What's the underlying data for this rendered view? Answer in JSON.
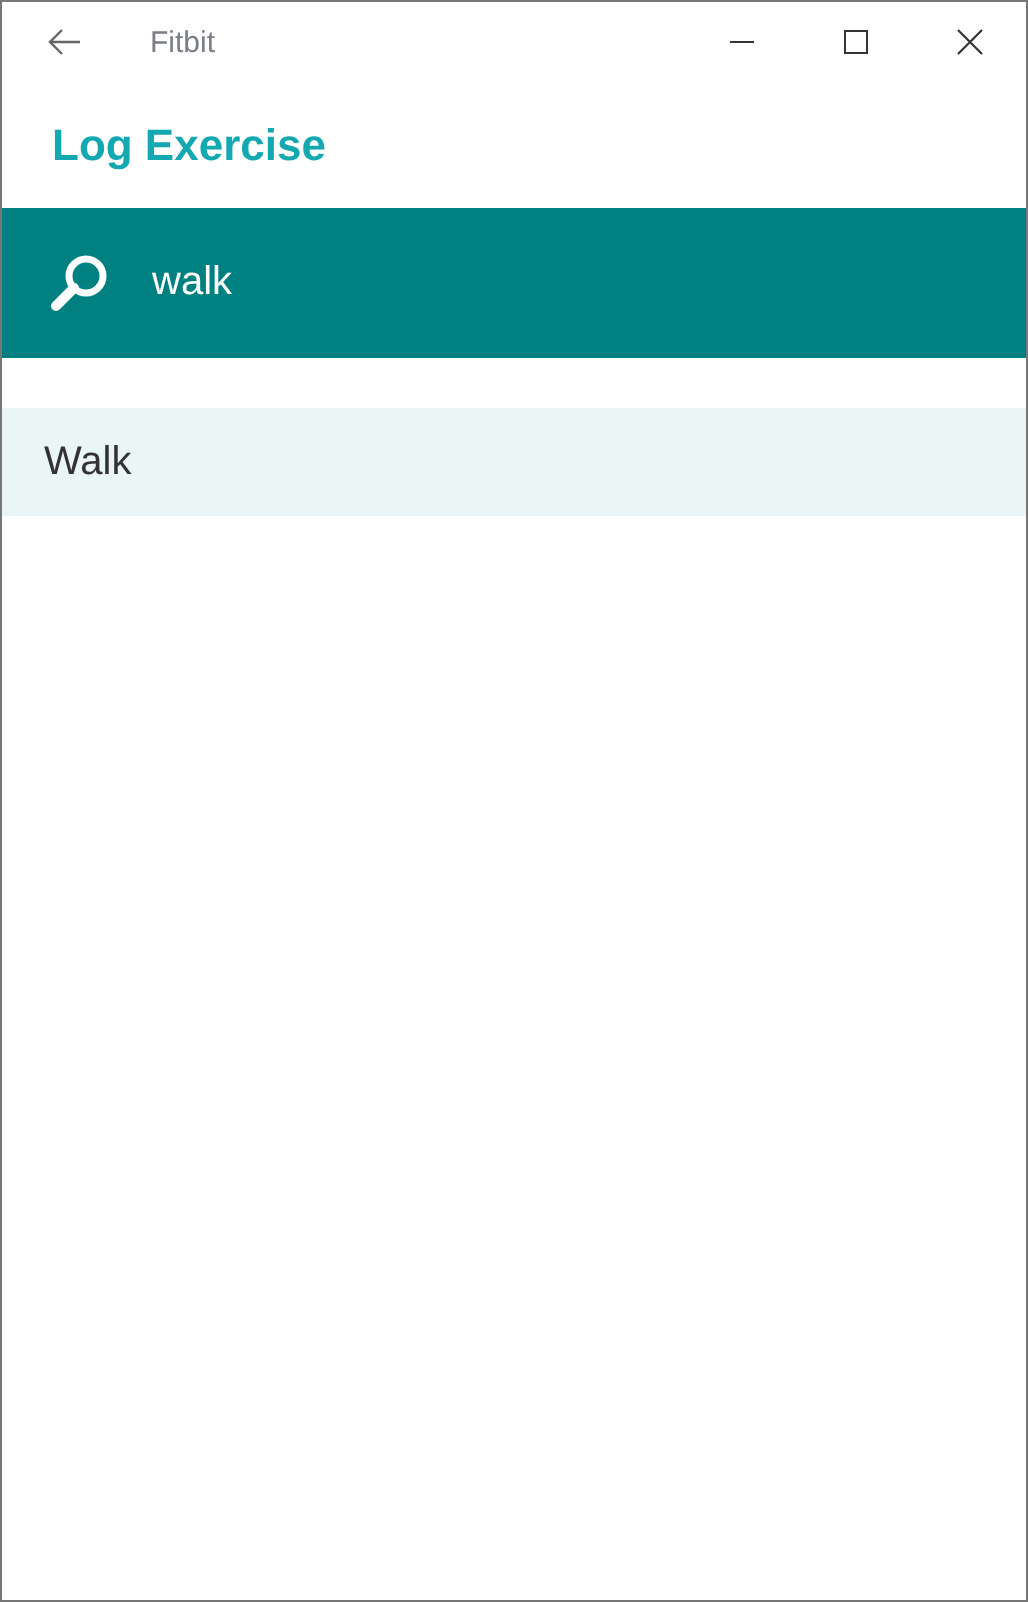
{
  "window": {
    "title": "Fitbit"
  },
  "page_title": "Log Exercise",
  "search": {
    "value": "walk"
  },
  "results": [
    {
      "label": "Walk",
      "selected": true
    }
  ]
}
